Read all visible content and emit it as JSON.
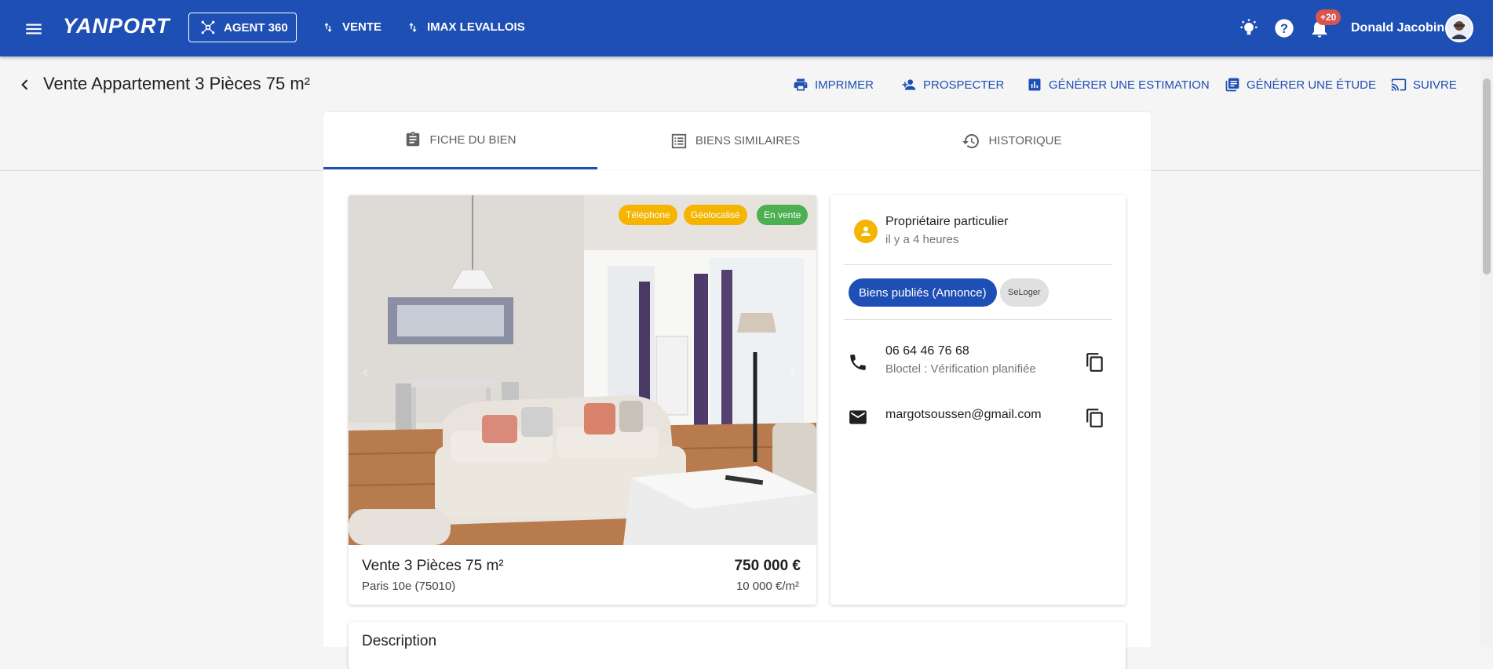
{
  "topbar": {
    "logo": "YANPORT",
    "agent_button": "AGENT 360",
    "nav": [
      "VENTE",
      "IMAX LEVALLOIS"
    ],
    "notification_count": "+20",
    "user_name": "Donald Jacobin",
    "accent_color": "#1e4fb4"
  },
  "subheader": {
    "title": "Vente Appartement 3 Pièces 75 m²",
    "actions": [
      "IMPRIMER",
      "PROSPECTER",
      "GÉNÉRER UNE ESTIMATION",
      "GÉNÉRER UNE ÉTUDE",
      "SUIVRE"
    ]
  },
  "tabs": [
    {
      "label": "FICHE DU BIEN",
      "icon": "clipboard-icon",
      "active": true
    },
    {
      "label": "BIENS SIMILAIRES",
      "icon": "list-icon",
      "active": false
    },
    {
      "label": "HISTORIQUE",
      "icon": "history-icon",
      "active": false
    }
  ],
  "listing": {
    "badges": [
      {
        "label": "Téléphone",
        "color": "#f4b400"
      },
      {
        "label": "Géolocalisé",
        "color": "#f4b400"
      },
      {
        "label": "En vente",
        "color": "#4caf50"
      }
    ],
    "title": "Vente 3 Pièces 75 m²",
    "location": "Paris 10e (75010)",
    "price": "750 000 €",
    "price_per_m2": "10 000 €/m²"
  },
  "owner": {
    "type": "Propriétaire particulier",
    "time": "il y a 4 heures",
    "chip_primary": "Biens publiés (Annonce)",
    "chip_secondary": "SeLoger",
    "phone": "06 64 46 76 68",
    "phone_note": "Bloctel : Vérification planifiée",
    "email": "margotsoussen@gmail.com"
  },
  "description": {
    "title": "Description"
  }
}
